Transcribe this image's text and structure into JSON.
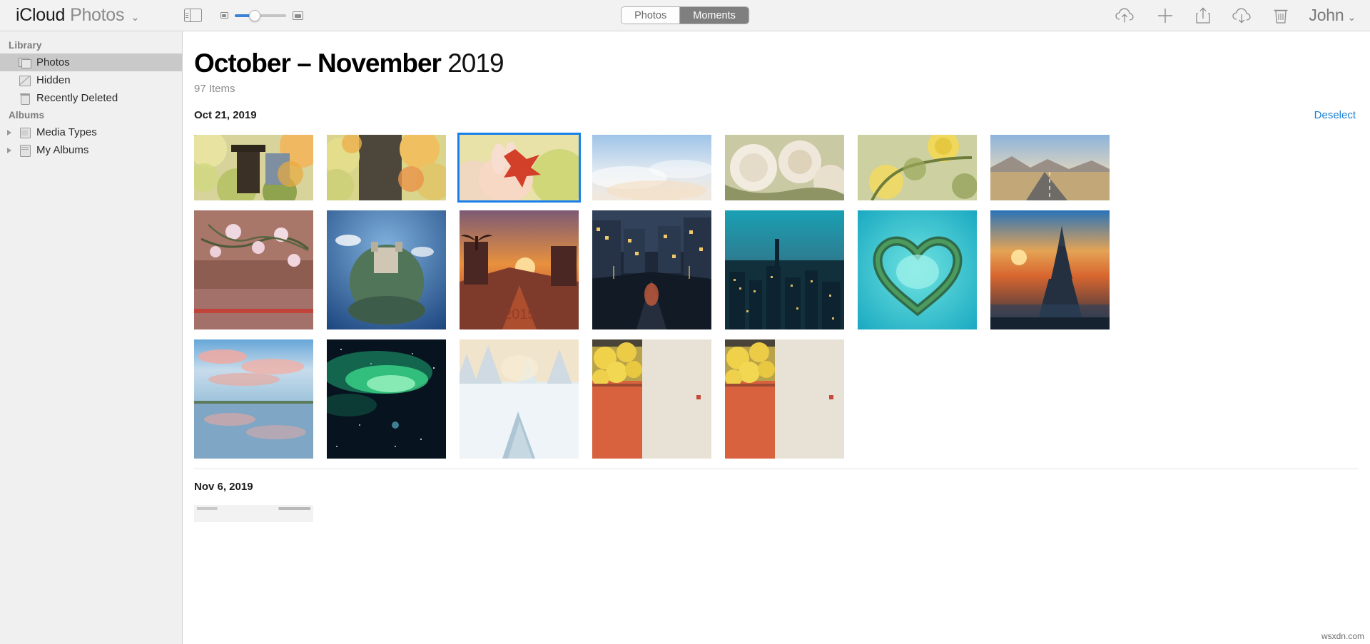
{
  "toolbar": {
    "brand_primary": "iCloud",
    "brand_secondary": "Photos",
    "brand_chevron": "⌄",
    "sidebar_toggle_name": "sidebar-toggle",
    "segmented": [
      {
        "label": "Photos",
        "active": false
      },
      {
        "label": "Moments",
        "active": true
      }
    ],
    "actions": [
      {
        "name": "upload-icon",
        "label": "Upload"
      },
      {
        "name": "add-icon",
        "label": "Add"
      },
      {
        "name": "share-icon",
        "label": "Share"
      },
      {
        "name": "download-icon",
        "label": "Download"
      },
      {
        "name": "delete-icon",
        "label": "Delete"
      }
    ],
    "account_name": "John",
    "account_chevron": "⌄"
  },
  "sidebar": {
    "sections": [
      {
        "header": "Library",
        "items": [
          {
            "label": "Photos",
            "icon": "photos-stack-icon",
            "selected": true
          },
          {
            "label": "Hidden",
            "icon": "hidden-icon",
            "selected": false
          },
          {
            "label": "Recently Deleted",
            "icon": "trash-icon",
            "selected": false
          }
        ]
      },
      {
        "header": "Albums",
        "items": [
          {
            "label": "Media Types",
            "icon": "album-icon",
            "expandable": true
          },
          {
            "label": "My Albums",
            "icon": "albums-icon",
            "expandable": true
          }
        ]
      }
    ]
  },
  "main": {
    "title_range": "October – November",
    "title_year": "2019",
    "items_count": "97 Items",
    "moments": [
      {
        "date": "Oct 21, 2019",
        "action_label": "Deselect",
        "rows": [
          [
            {
              "name": "photo-autumn-shrine",
              "selected": false
            },
            {
              "name": "photo-maple-tree",
              "selected": false
            },
            {
              "name": "photo-hand-red-leaf",
              "selected": true
            },
            {
              "name": "photo-blue-sky-clouds",
              "selected": false
            },
            {
              "name": "photo-white-roses",
              "selected": false
            },
            {
              "name": "photo-yellow-rose",
              "selected": false
            },
            {
              "name": "photo-desert-road",
              "selected": false
            }
          ],
          [
            {
              "name": "photo-pink-blossom-wall",
              "selected": false
            },
            {
              "name": "photo-tiny-planet-castle",
              "selected": false
            },
            {
              "name": "photo-palm-street-sunset",
              "selected": false
            },
            {
              "name": "photo-night-city-street",
              "selected": false
            },
            {
              "name": "photo-city-skyline-dusk",
              "selected": false
            },
            {
              "name": "photo-heart-island-lagoon",
              "selected": false
            },
            {
              "name": "photo-eiffel-tower-sunset",
              "selected": false
            }
          ],
          [
            {
              "name": "photo-lake-pink-clouds",
              "selected": false
            },
            {
              "name": "photo-aurora-green",
              "selected": false
            },
            {
              "name": "photo-snow-forest-stream",
              "selected": false
            },
            {
              "name": "photo-yellow-ginkgo-wall",
              "selected": false
            },
            {
              "name": "photo-yellow-ginkgo-wall-2",
              "selected": false
            }
          ]
        ]
      },
      {
        "date": "Nov 6, 2019",
        "action_label": "",
        "rows": [
          [
            {
              "name": "photo-screenshot-clip",
              "selected": false
            }
          ]
        ]
      }
    ]
  },
  "watermark": "wsxdn.com",
  "colors": {
    "accent_blue": "#1a7fd4",
    "selection_blue": "#1a7fe8",
    "toolbar_bg": "#f2f2f2",
    "sidebar_bg": "#f0f0f0",
    "sidebar_selected": "#c9c9c9",
    "segment_active_bg": "#7f7f7f"
  }
}
